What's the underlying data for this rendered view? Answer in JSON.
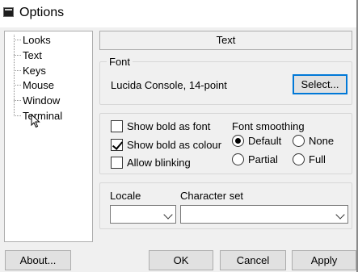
{
  "window": {
    "title": "Options"
  },
  "tree": {
    "items": [
      {
        "label": "Looks"
      },
      {
        "label": "Text"
      },
      {
        "label": "Keys"
      },
      {
        "label": "Mouse"
      },
      {
        "label": "Window"
      },
      {
        "label": "Terminal"
      }
    ]
  },
  "panel": {
    "header": "Text",
    "font_group": {
      "title": "Font",
      "current": "Lucida Console, 14-point",
      "select_button": "Select..."
    },
    "options": {
      "show_bold_as_font": {
        "label": "Show bold as font",
        "checked": false
      },
      "show_bold_as_colour": {
        "label": "Show bold as colour",
        "checked": true
      },
      "allow_blinking": {
        "label": "Allow blinking",
        "checked": false
      }
    },
    "smoothing": {
      "title": "Font smoothing",
      "default": {
        "label": "Default",
        "selected": true
      },
      "none": {
        "label": "None",
        "selected": false
      },
      "partial": {
        "label": "Partial",
        "selected": false
      },
      "full": {
        "label": "Full",
        "selected": false
      }
    },
    "locale": {
      "label": "Locale",
      "value": ""
    },
    "charset": {
      "label": "Character set",
      "value": ""
    }
  },
  "buttons": {
    "about": "About...",
    "ok": "OK",
    "cancel": "Cancel",
    "apply": "Apply"
  },
  "icons": {
    "app": "terminal-icon",
    "cursor": "mouse-pointer-icon"
  }
}
